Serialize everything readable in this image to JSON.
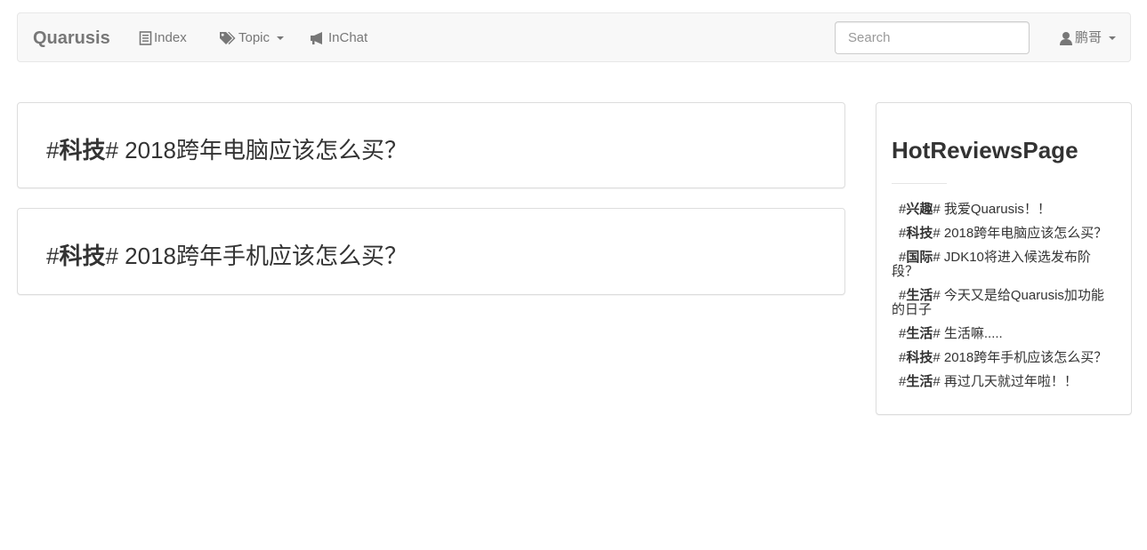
{
  "navbar": {
    "brand": "Quarusis",
    "items": [
      {
        "label": "Index",
        "icon": "list-icon"
      },
      {
        "label": "Topic",
        "icon": "tags-icon"
      },
      {
        "label": "InChat",
        "icon": "megaphone-icon"
      }
    ],
    "search_placeholder": "Search",
    "user": {
      "label": "鹏哥",
      "icon": "user-icon"
    }
  },
  "posts": [
    {
      "tag": "科技",
      "title": "2018跨年电脑应该怎么买？"
    },
    {
      "tag": "科技",
      "title": "2018跨年手机应该怎么买？"
    }
  ],
  "sidebar": {
    "title": "HotReviewsPage",
    "items": [
      {
        "tag": "兴趣",
        "title": "我爱Quarusis！！"
      },
      {
        "tag": "科技",
        "title": "2018跨年电脑应该怎么买？"
      },
      {
        "tag": "国际",
        "title": "JDK10将进入候选发布阶段？"
      },
      {
        "tag": "生活",
        "title": "今天又是给Quarusis加功能的日子"
      },
      {
        "tag": "生活",
        "title": "生活嘛....."
      },
      {
        "tag": "科技",
        "title": "2018跨年手机应该怎么买？"
      },
      {
        "tag": "生活",
        "title": "再过几天就过年啦！！"
      }
    ]
  },
  "colors": {
    "navbar_bg": "#f8f8f8",
    "nav_text": "#777777",
    "text": "#333333",
    "border": "#dddddd"
  }
}
